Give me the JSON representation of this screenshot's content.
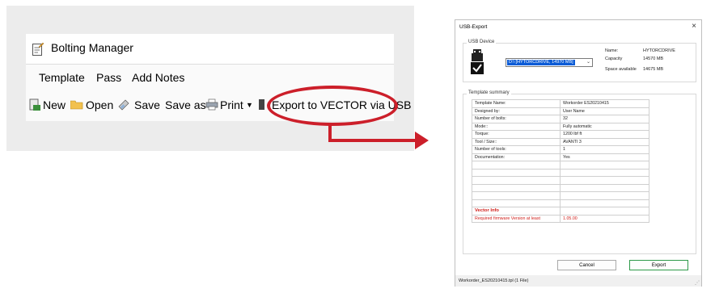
{
  "app": {
    "title": "Bolting Manager",
    "menu": [
      "Template",
      "Pass",
      "Add Notes"
    ],
    "toolbar": {
      "new": "New",
      "open": "Open",
      "save": "Save",
      "save_as": "Save as",
      "print": "Print",
      "export": "Export to VECTOR via USB"
    }
  },
  "dialog": {
    "title": "USB-Export",
    "close": "×",
    "usb_group_label": "USB Device",
    "device_selected": "D:\\ [HYTORCDRIVE, 14970 MB]",
    "device_info": [
      {
        "label": "Name:",
        "value": "HYTORCDRIVE"
      },
      {
        "label": "Capacity",
        "value": "14570 MB"
      },
      {
        "label": "Space available",
        "value": "14675 MB"
      }
    ],
    "summary_label": "Template summary",
    "rows": [
      {
        "label": "Template Name:",
        "value": "Workorder ES20210415"
      },
      {
        "label": "Designed by:",
        "value": "User Name"
      },
      {
        "label": "Number of bolts:",
        "value": "32"
      },
      {
        "label": "Mode::",
        "value": "Fully automatic"
      },
      {
        "label": "Torque:",
        "value": "1200 lbf ft"
      },
      {
        "label": "Tool / Size::",
        "value": "AVANTI 3"
      },
      {
        "label": "Number of tools:",
        "value": "1"
      },
      {
        "label": "Documentation:",
        "value": "Yes"
      },
      {
        "label": "",
        "value": ""
      },
      {
        "label": "",
        "value": ""
      },
      {
        "label": "",
        "value": ""
      },
      {
        "label": "",
        "value": ""
      },
      {
        "label": "",
        "value": ""
      },
      {
        "label": "",
        "value": ""
      }
    ],
    "vector_info": "Vector Info",
    "firmware_label": "Required firmware Version at least",
    "firmware_value": "1.05.00",
    "cancel": "Cancel",
    "export": "Export",
    "status": "Workorder_ES20210415.tpl (1 File)"
  },
  "colors": {
    "callout": "#cc1f2a",
    "selection": "#0a5bd6",
    "vector_red": "#d0201b",
    "export_border": "#2e9a4a"
  }
}
